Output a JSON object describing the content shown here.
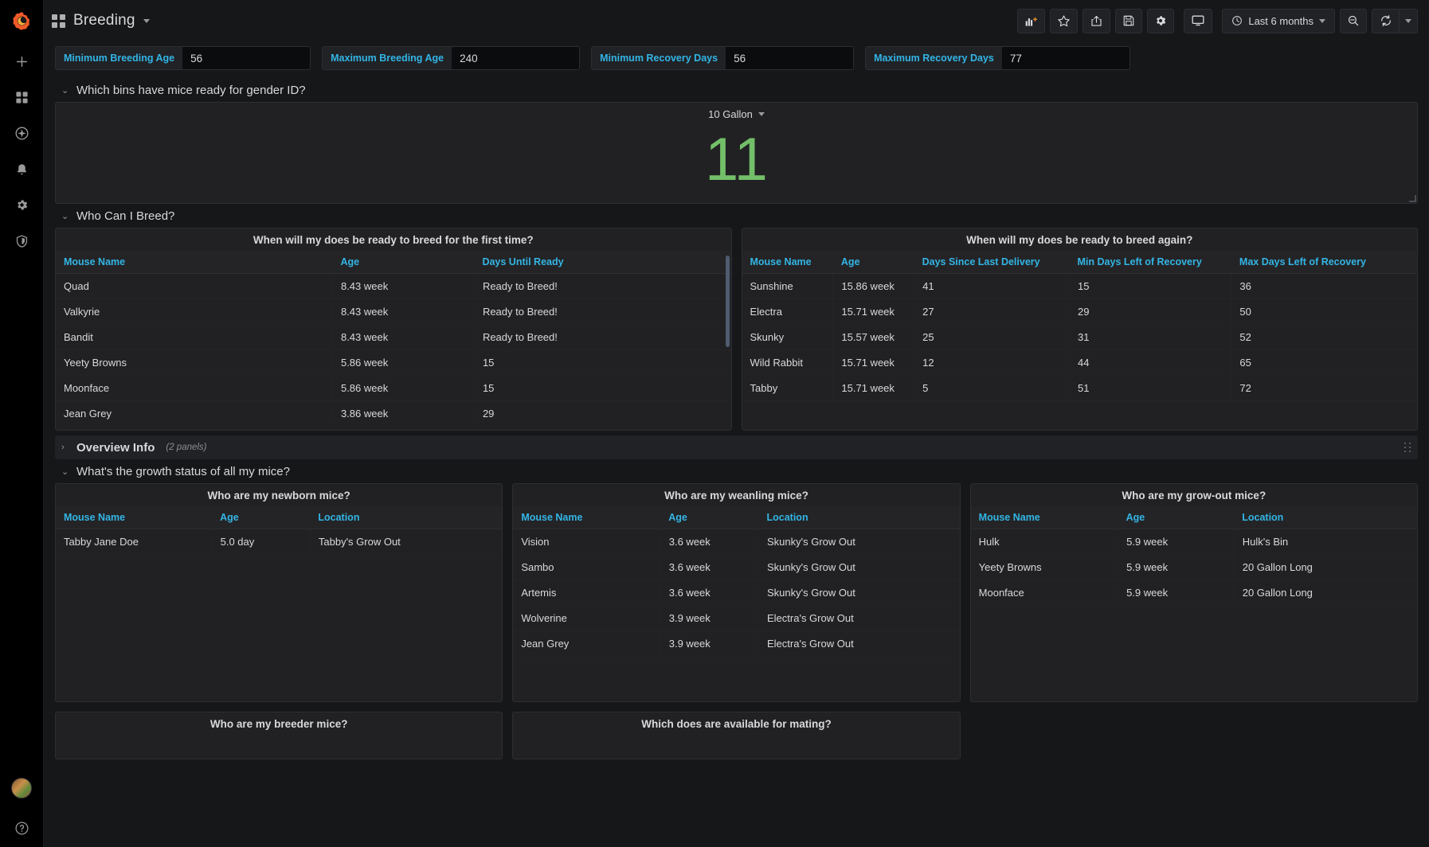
{
  "app": {
    "brand_icon": "grafana-logo-icon",
    "sidebar_items": [
      {
        "icon": "plus-icon",
        "name": "create"
      },
      {
        "icon": "dashboards-icon",
        "name": "dashboards"
      },
      {
        "icon": "compass-icon",
        "name": "explore"
      },
      {
        "icon": "bell-icon",
        "name": "alerting"
      },
      {
        "icon": "gear-icon",
        "name": "configuration"
      },
      {
        "icon": "shield-icon",
        "name": "server-admin"
      }
    ],
    "sidebar_bottom": [
      {
        "icon": "avatar-icon",
        "name": "user-profile"
      },
      {
        "icon": "help-icon",
        "name": "help",
        "glyph": "?"
      }
    ]
  },
  "navbar": {
    "dashboard_title": "Breeding",
    "caret": "▾",
    "buttons": [
      {
        "name": "add-panel-button",
        "icon": "add-panel-icon",
        "title": "Add panel"
      },
      {
        "name": "star-button",
        "icon": "star-icon",
        "title": "Mark as favorite"
      },
      {
        "name": "share-button",
        "icon": "share-icon",
        "title": "Share dashboard"
      },
      {
        "name": "save-button",
        "icon": "save-icon",
        "title": "Save dashboard"
      },
      {
        "name": "settings-button",
        "icon": "gear-icon",
        "title": "Dashboard settings"
      },
      {
        "name": "tv-mode-button",
        "icon": "monitor-icon",
        "title": "Cycle view mode"
      }
    ],
    "time_picker": {
      "icon": "clock-icon",
      "label": "Last 6 months",
      "caret": "▾"
    },
    "zoom_out": {
      "name": "zoom-out-button",
      "icon": "zoom-out-icon"
    },
    "refresh": {
      "name": "refresh-button",
      "icon": "refresh-icon"
    },
    "refresh_interval_caret": "▾"
  },
  "variables": [
    {
      "label": "Minimum Breeding Age",
      "value": "56"
    },
    {
      "label": "Maximum Breeding Age",
      "value": "240"
    },
    {
      "label": "Minimum Recovery Days",
      "value": "56"
    },
    {
      "label": "Maximum Recovery Days",
      "value": "77"
    }
  ],
  "rows": {
    "gender_id": {
      "chevron": "⌄",
      "title": "Which bins have mice ready for gender ID?",
      "stat_panel": {
        "selector_label": "10 Gallon",
        "selector_caret": "▾",
        "value": "11",
        "value_color": "#73bf69"
      }
    },
    "who_can_breed": {
      "chevron": "⌄",
      "title": "Who Can I Breed?",
      "panels": [
        {
          "title": "When will my does be ready to breed for the first time?",
          "columns": [
            "Mouse Name",
            "Age",
            "Days Until Ready"
          ],
          "rows": [
            [
              "Quad",
              "8.43 week",
              "Ready to Breed!"
            ],
            [
              "Valkyrie",
              "8.43 week",
              "Ready to Breed!"
            ],
            [
              "Bandit",
              "8.43 week",
              "Ready to Breed!"
            ],
            [
              "Yeety Browns",
              "5.86 week",
              "15"
            ],
            [
              "Moonface",
              "5.86 week",
              "15"
            ],
            [
              "Jean Grey",
              "3.86 week",
              "29"
            ]
          ]
        },
        {
          "title": "When will my does be ready to breed again?",
          "columns": [
            "Mouse Name",
            "Age",
            "Days Since Last Delivery",
            "Min Days Left of Recovery",
            "Max Days Left of Recovery"
          ],
          "rows": [
            [
              "Sunshine",
              "15.86 week",
              "41",
              "15",
              "36"
            ],
            [
              "Electra",
              "15.71 week",
              "27",
              "29",
              "50"
            ],
            [
              "Skunky",
              "15.57 week",
              "25",
              "31",
              "52"
            ],
            [
              "Wild Rabbit",
              "15.71 week",
              "12",
              "44",
              "65"
            ],
            [
              "Tabby",
              "15.71 week",
              "5",
              "51",
              "72"
            ]
          ]
        }
      ]
    },
    "overview_info": {
      "chevron": "›",
      "title": "Overview Info",
      "count": "(2 panels)"
    },
    "growth_status": {
      "chevron": "⌄",
      "title": "What's the growth status of all my mice?",
      "panels": [
        {
          "title": "Who are my newborn mice?",
          "columns": [
            "Mouse Name",
            "Age",
            "Location"
          ],
          "rows": [
            [
              "Tabby Jane Doe",
              "5.0 day",
              "Tabby's Grow Out"
            ]
          ]
        },
        {
          "title": "Who are my weanling mice?",
          "columns": [
            "Mouse Name",
            "Age",
            "Location"
          ],
          "rows": [
            [
              "Vision",
              "3.6 week",
              "Skunky's Grow Out"
            ],
            [
              "Sambo",
              "3.6 week",
              "Skunky's Grow Out"
            ],
            [
              "Artemis",
              "3.6 week",
              "Skunky's Grow Out"
            ],
            [
              "Wolverine",
              "3.9 week",
              "Electra's Grow Out"
            ],
            [
              "Jean Grey",
              "3.9 week",
              "Electra's Grow Out"
            ]
          ]
        },
        {
          "title": "Who are my grow-out mice?",
          "columns": [
            "Mouse Name",
            "Age",
            "Location"
          ],
          "rows": [
            [
              "Hulk",
              "5.9 week",
              "Hulk's Bin"
            ],
            [
              "Yeety Browns",
              "5.9 week",
              "20 Gallon Long"
            ],
            [
              "Moonface",
              "5.9 week",
              "20 Gallon Long"
            ]
          ]
        }
      ]
    },
    "bottom_panels": [
      {
        "title": "Who are my breeder mice?"
      },
      {
        "title": "Which does are available for mating?"
      }
    ]
  },
  "colors": {
    "accent_blue": "#33b5e5",
    "stat_green": "#73bf69",
    "panel_bg": "#212124",
    "page_bg": "#161719"
  }
}
